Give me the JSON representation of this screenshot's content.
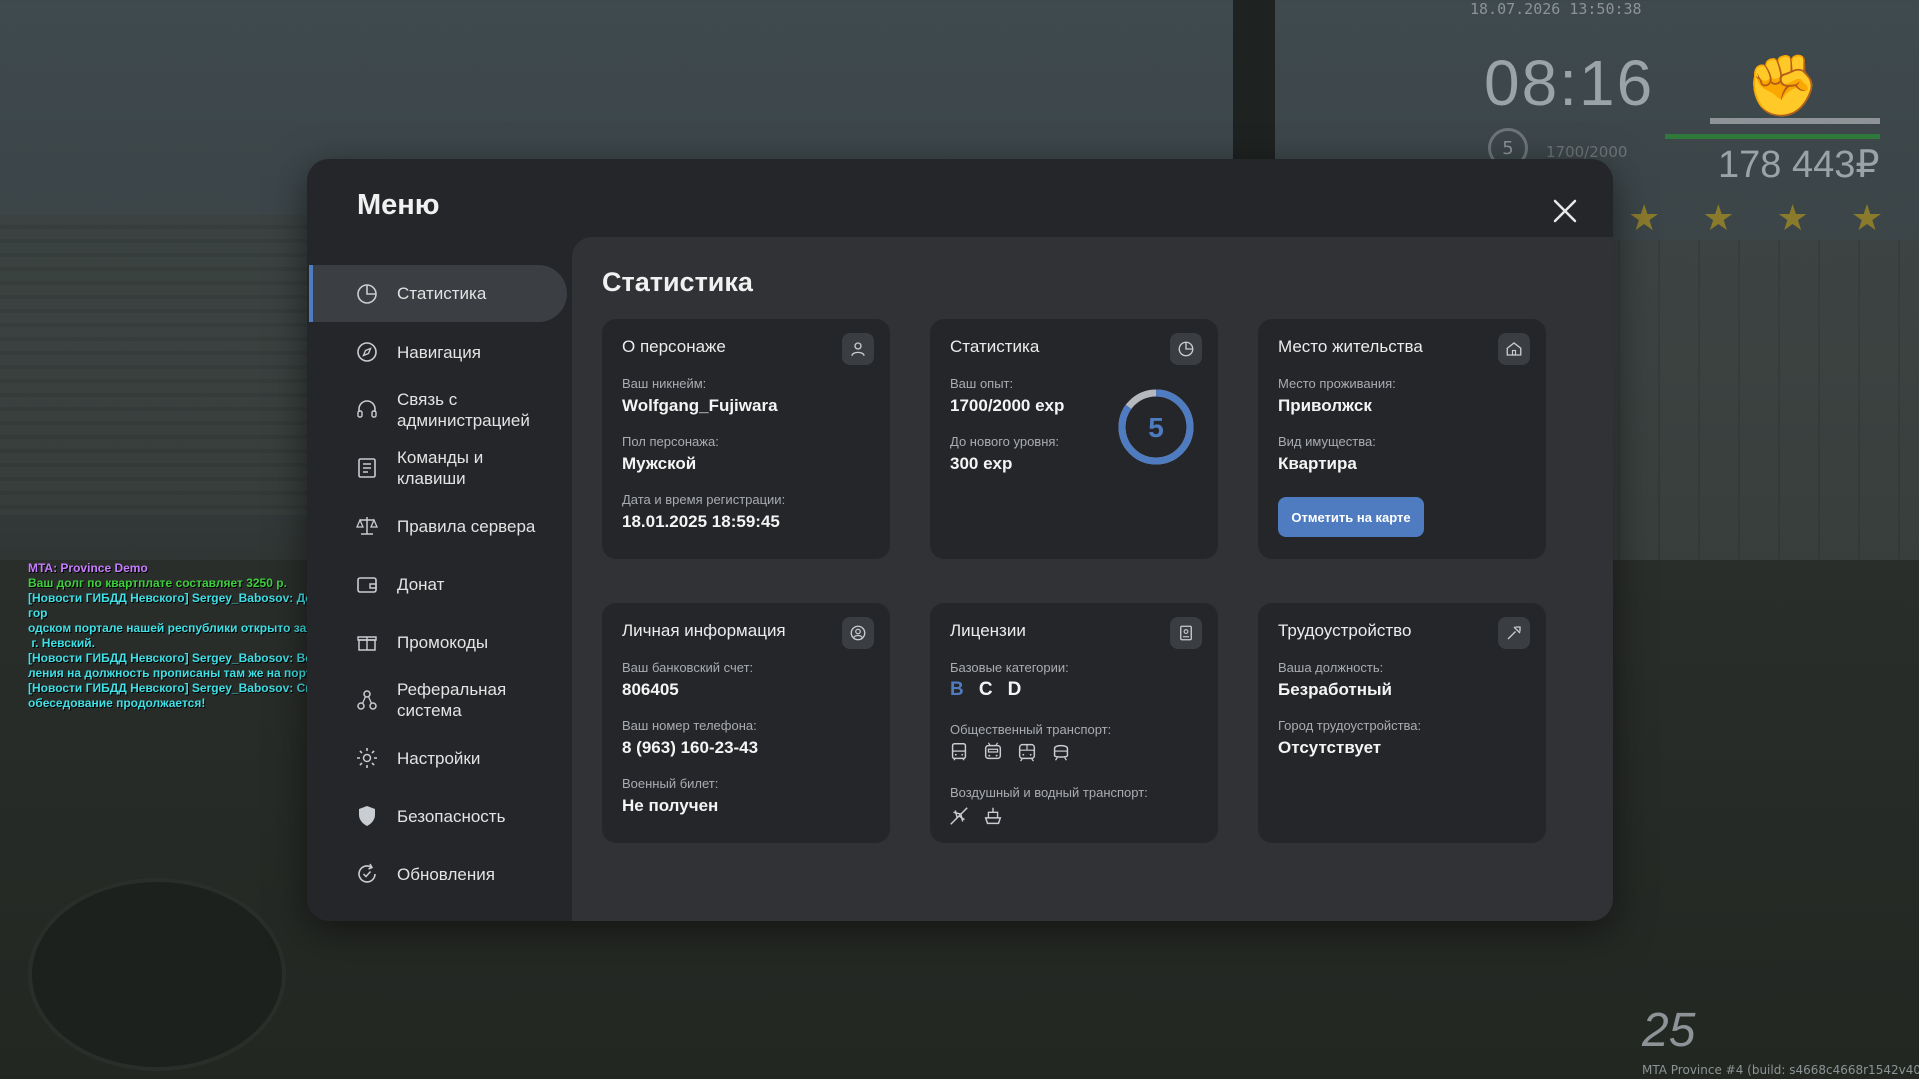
{
  "hud": {
    "date": "18.07.2026 13:50:38",
    "time": "08:16",
    "level": "5",
    "exp": "1700/2000",
    "money": "178 443₽",
    "fuel": "25",
    "build": "MTA Province #4 (build: s4668c4668r1542v4077)"
  },
  "chat": [
    {
      "text": "MTA: Province Demo",
      "color": "#c77dff"
    },
    {
      "text": "Ваш долг по квартплате составляет 3250 р.",
      "color": "#3cd13c"
    },
    {
      "text": "[Новости ГИБДД Невского] Sergey_Babosov: Дорогие жители Провинции! На гор\nодском портале нашей республики открыто заявления на Рядового в ГИБДД по\n г. Невский.",
      "color": "#3fe0e6"
    },
    {
      "text": "[Новости ГИБДД Невского] Sergey_Babosov: Все нужные критерии для поступ\nления на должность прописаны там же на портале. Ждём именно Вас!",
      "color": "#3fe0e6"
    },
    {
      "text": "[Новости ГИБДД Невского] Sergey_Babosov: Спасибо за внимание! Ну а наше с\nобеседование продолжается!",
      "color": "#3fe0e6"
    }
  ],
  "menu": {
    "title": "Меню",
    "nav": [
      {
        "label": "Статистика",
        "icon": "chart-pie-icon"
      },
      {
        "label": "Навигация",
        "icon": "compass-icon"
      },
      {
        "label": "Связь с администрацией",
        "icon": "headset-icon"
      },
      {
        "label": "Команды и клавиши",
        "icon": "list-icon"
      },
      {
        "label": "Правила сервера",
        "icon": "scales-icon"
      },
      {
        "label": "Донат",
        "icon": "wallet-icon"
      },
      {
        "label": "Промокоды",
        "icon": "gift-icon"
      },
      {
        "label": "Реферальная система",
        "icon": "referral-icon"
      },
      {
        "label": "Настройки",
        "icon": "gear-icon"
      },
      {
        "label": "Безопасность",
        "icon": "shield-icon"
      },
      {
        "label": "Обновления",
        "icon": "refresh-icon"
      }
    ]
  },
  "content": {
    "title": "Статистика",
    "character": {
      "title": "О персонаже",
      "nick_label": "Ваш никнейм:",
      "nick": "Wolfgang_Fujiwara",
      "gender_label": "Пол персонажа:",
      "gender": "Мужской",
      "reg_label": "Дата и время регистрации:",
      "reg": "18.01.2025 18:59:45"
    },
    "stats": {
      "title": "Статистика",
      "exp_label": "Ваш опыт:",
      "exp": "1700/2000 exp",
      "next_label": "До нового уровня:",
      "next": "300 exp",
      "level": "5",
      "progress": 0.85
    },
    "home": {
      "title": "Место жительства",
      "place_label": "Место проживания:",
      "place": "Приволжск",
      "prop_label": "Вид имущества:",
      "prop": "Квартира",
      "button": "Отметить на карте"
    },
    "personal": {
      "title": "Личная информация",
      "bank_label": "Ваш банковский счет:",
      "bank": "806405",
      "phone_label": "Ваш номер телефона:",
      "phone": "8 (963) 160-23-43",
      "military_label": "Военный билет:",
      "military": "Не получен"
    },
    "licenses": {
      "title": "Лицензии",
      "base_label": "Базовые категории:",
      "categories": [
        {
          "name": "B",
          "owned": true
        },
        {
          "name": "C",
          "owned": false
        },
        {
          "name": "D",
          "owned": false
        }
      ],
      "public_label": "Общественный транспорт:",
      "air_label": "Воздушный и водный транспорт:"
    },
    "job": {
      "title": "Трудоустройство",
      "pos_label": "Ваша должность:",
      "pos": "Безработный",
      "city_label": "Город трудоустройства:",
      "city": "Отсутствует"
    }
  }
}
